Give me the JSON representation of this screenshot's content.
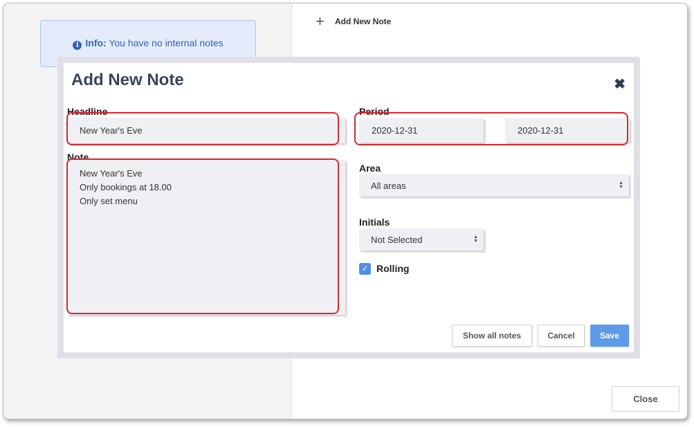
{
  "background": {
    "info": {
      "label": "Info:",
      "text": "You have no internal notes"
    },
    "add_note_link": "Add New Note",
    "close_button": "Close"
  },
  "modal": {
    "title": "Add New Note",
    "close_icon": "✖",
    "headline": {
      "label": "Headline",
      "value": "New Year's Eve"
    },
    "note": {
      "label": "Note",
      "value": "New Year's Eve\nOnly bookings at 18.00\nOnly set menu"
    },
    "period": {
      "label": "Period",
      "start": "2020-12-31",
      "end": "2020-12-31"
    },
    "area": {
      "label": "Area",
      "selected": "All areas"
    },
    "initials": {
      "label": "Initials",
      "selected": "Not Selected"
    },
    "rolling": {
      "label": "Rolling",
      "checked": true
    },
    "buttons": {
      "show_all": "Show all notes",
      "cancel": "Cancel",
      "save": "Save"
    }
  },
  "colors": {
    "accent": "#5d9be8",
    "highlight": "#d9262c",
    "info_text": "#2f63b8"
  }
}
